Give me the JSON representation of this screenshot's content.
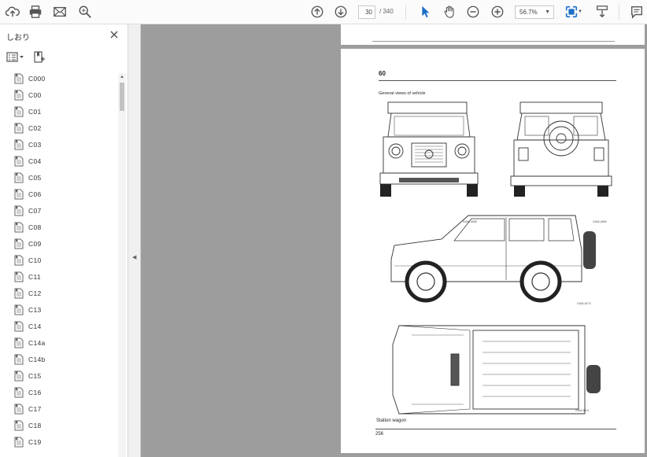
{
  "toolbar": {
    "page_current": "30",
    "page_total": "/ 340",
    "zoom": "56.7%",
    "icons": [
      "cloud-upload-icon",
      "print-icon",
      "mail-icon",
      "search-icon",
      "page-up-icon",
      "page-down-icon",
      "select-arrow-icon",
      "hand-icon",
      "zoom-out-icon",
      "zoom-in-icon",
      "fit-page-icon",
      "scroll-mode-icon",
      "comment-icon"
    ]
  },
  "sidebar": {
    "title": "しおり",
    "bookmarks": [
      "C000",
      "C00",
      "C01",
      "C02",
      "C03",
      "C04",
      "C05",
      "C06",
      "C07",
      "C08",
      "C09",
      "C10",
      "C11",
      "C12",
      "C13",
      "C14",
      "C14a",
      "C14b",
      "C15",
      "C16",
      "C17",
      "C18",
      "C19"
    ]
  },
  "document": {
    "page_heading": "60",
    "figure_title": "General views of vehicle",
    "figure_footer": "Station wagon",
    "page_number": "256",
    "drawing_codes": [
      "G404-4458",
      "G404-4459",
      "G404-5170",
      "G404-5171"
    ]
  },
  "colors": {
    "accent": "#1a6fc9",
    "doc_background": "#9d9d9d"
  }
}
